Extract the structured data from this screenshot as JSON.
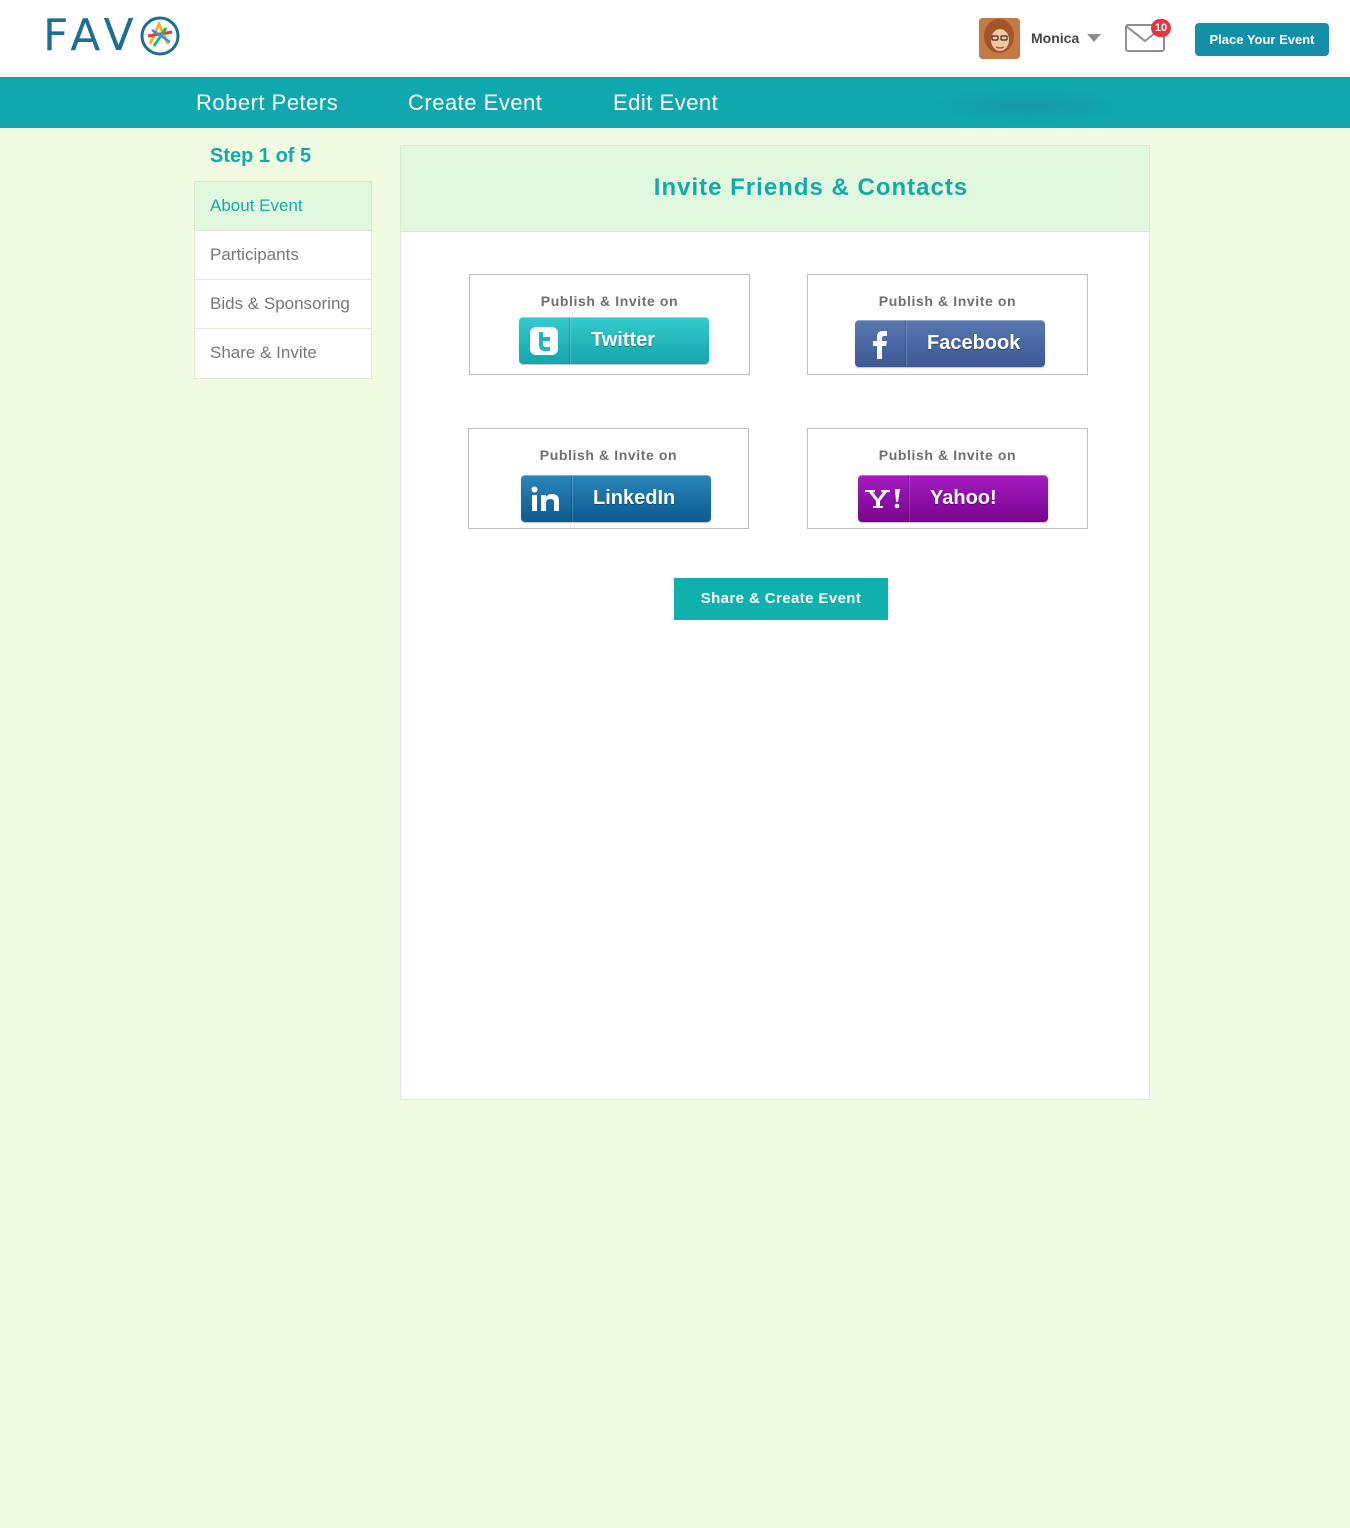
{
  "header": {
    "logo_text": "FAV",
    "user_name": "Monica",
    "mail_count": "10",
    "place_event_label": "Place Your Event"
  },
  "nav": {
    "items": [
      {
        "label": "Robert Peters"
      },
      {
        "label": "Create Event"
      },
      {
        "label": "Edit Event"
      }
    ]
  },
  "sidebar": {
    "step_label": "Step 1 of 5",
    "items": [
      {
        "label": "About Event",
        "active": true
      },
      {
        "label": "Participants",
        "active": false
      },
      {
        "label": "Bids & Sponsoring",
        "active": false
      },
      {
        "label": "Share & Invite",
        "active": false
      }
    ]
  },
  "panel": {
    "title": "Invite Friends & Contacts",
    "cards": [
      {
        "label": "Publish & Invite on",
        "network": "Twitter",
        "icon": "twitter-icon",
        "color": "#1fb7bc"
      },
      {
        "label": "Publish & Invite on",
        "network": "Facebook",
        "icon": "facebook-icon",
        "color": "#4a67a2"
      },
      {
        "label": "Publish & Invite on",
        "network": "LinkedIn",
        "icon": "linkedin-icon",
        "color": "#1570a4"
      },
      {
        "label": "Publish & Invite on",
        "network": "Yahoo!",
        "icon": "yahoo-icon",
        "color": "#8e10a9"
      }
    ],
    "cta_label": "Share & Create Event"
  },
  "colors": {
    "accent": "#0ea8ae",
    "page_background": "#f1fbe2",
    "header_button": "#138fa8",
    "badge": "#e8343e"
  }
}
